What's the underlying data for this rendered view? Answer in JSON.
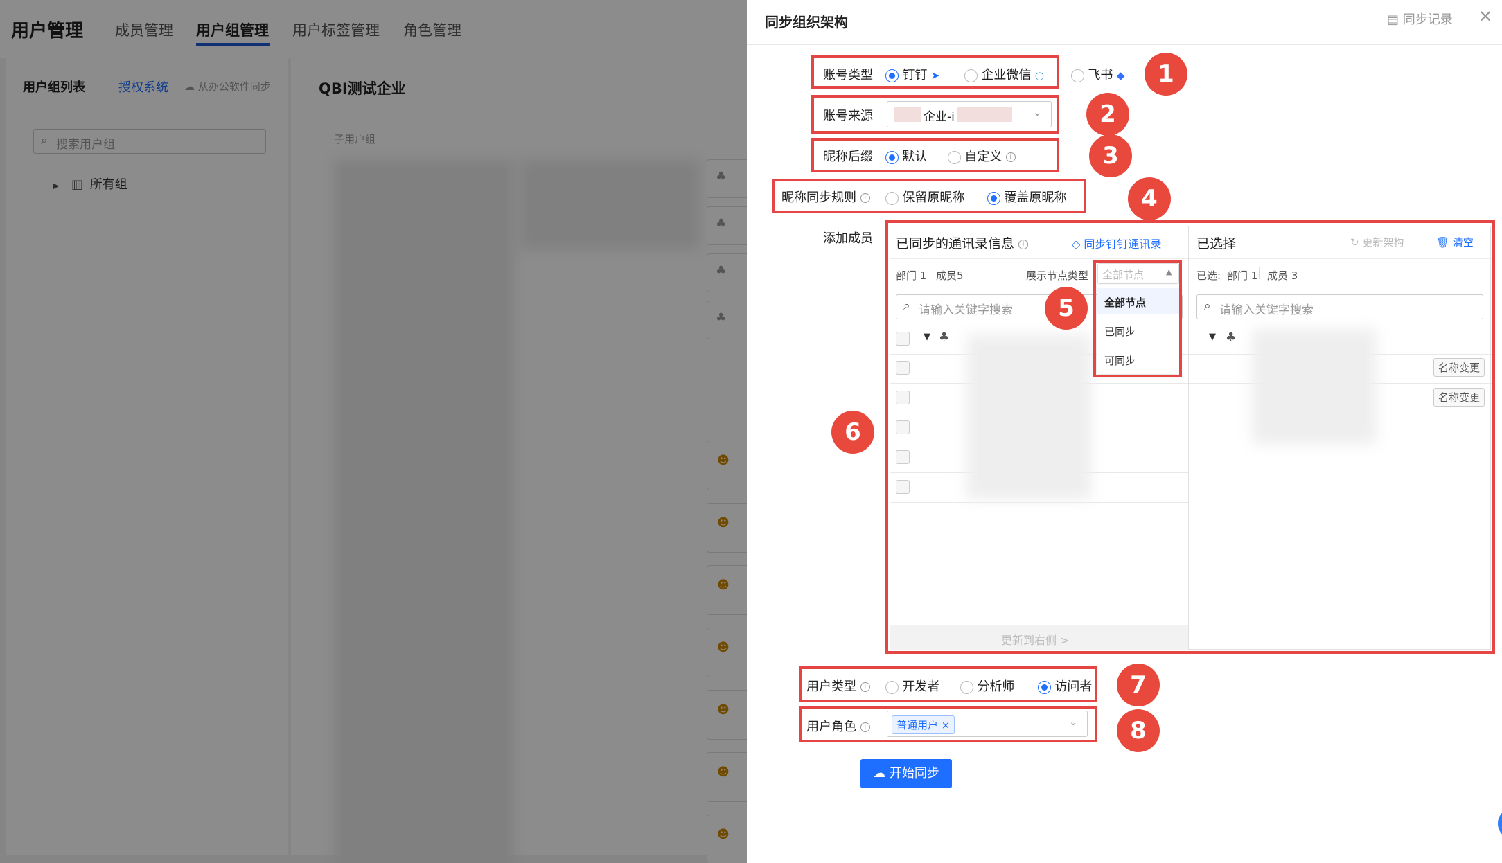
{
  "background": {
    "title": "用户管理",
    "tabs": [
      "成员管理",
      "用户组管理",
      "用户标签管理",
      "角色管理"
    ],
    "active_tab": "用户组管理",
    "left": {
      "heading": "用户组列表",
      "auth_link": "授权系统",
      "sync_link": "从办公软件同步",
      "search_placeholder": "搜索用户组",
      "tree_root": "所有组"
    },
    "middle": {
      "company": "QBI测试企业",
      "subgroup_label": "子用户组"
    }
  },
  "drawer": {
    "title": "同步组织架构",
    "sync_record": "同步记录",
    "account_type": {
      "label": "账号类型",
      "options": [
        "钉钉",
        "企业微信",
        "飞书"
      ],
      "selected": "钉钉"
    },
    "account_source": {
      "label": "账号来源",
      "value": "企业-i"
    },
    "nickname_suffix": {
      "label": "昵称后缀",
      "options": [
        "默认",
        "自定义"
      ],
      "selected": "默认"
    },
    "nickname_rule": {
      "label": "昵称同步规则",
      "options": [
        "保留原昵称",
        "覆盖原昵称"
      ],
      "selected": "覆盖原昵称"
    },
    "add_members": {
      "label": "添加成员",
      "left_panel": {
        "title": "已同步的通讯录信息",
        "sync_link": "同步钉钉通讯录",
        "dept_count": "部门 1",
        "member_count": "成员5",
        "node_type_label": "展示节点类型",
        "node_type_value": "全部节点",
        "dropdown_options": [
          "全部节点",
          "已同步",
          "可同步"
        ],
        "search_placeholder": "请输入关键字搜索",
        "footer": "更新到右侧 >"
      },
      "right_panel": {
        "title": "已选择",
        "refresh": "更新架构",
        "clear": "清空",
        "selected_prefix": "已选:",
        "dept_count": "部门 1",
        "member_count": "成员 3",
        "search_placeholder": "请输入关键字搜索",
        "rename_tag": "名称变更"
      }
    },
    "user_type": {
      "label": "用户类型",
      "options": [
        "开发者",
        "分析师",
        "访问者"
      ],
      "selected": "访问者"
    },
    "user_role": {
      "label": "用户角色",
      "tag": "普通用户"
    },
    "start_button": "开始同步"
  },
  "annotations": [
    "1",
    "2",
    "3",
    "4",
    "5",
    "6",
    "7",
    "8"
  ],
  "colors": {
    "accent": "#1e6fff",
    "annotation_red": "#e8493c",
    "box_red": "#e64545"
  }
}
